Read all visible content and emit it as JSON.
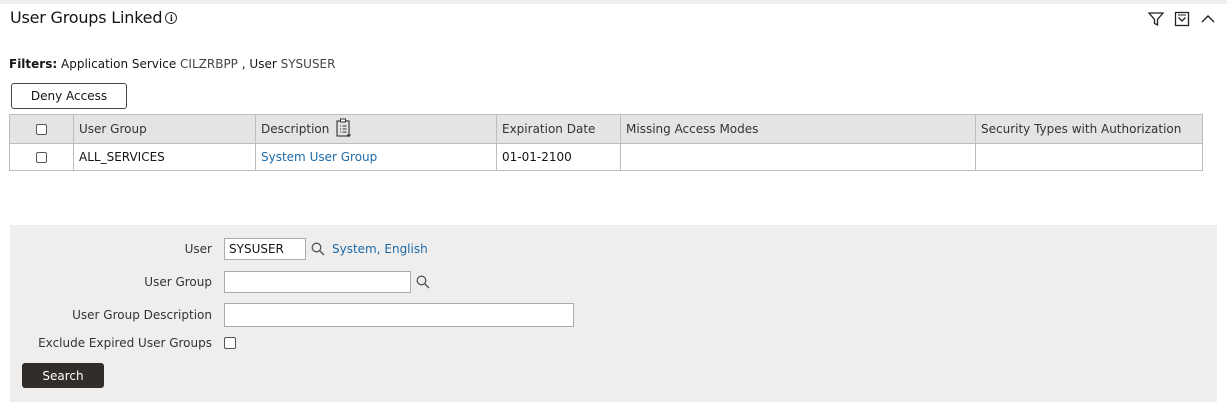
{
  "header": {
    "title": "User Groups Linked",
    "info_icon": "info-icon",
    "actions": [
      "filter-icon",
      "dropdown-box-icon",
      "chevron-up-icon"
    ]
  },
  "filters": {
    "label": "Filters:",
    "text_prefix": "Application Service",
    "service_value": "CILZRBPP",
    "separator": ",",
    "user_label": "User",
    "user_value": "SYSUSER"
  },
  "toolbar": {
    "deny_label": "Deny Access"
  },
  "table": {
    "columns": [
      "User Group",
      "Description",
      "Expiration Date",
      "Missing Access Modes",
      "Security Types with Authorization"
    ],
    "rows": [
      {
        "user_group": "ALL_SERVICES",
        "description": "System User Group",
        "expiration_date": "01-01-2100",
        "missing_access_modes": "",
        "security_types": ""
      }
    ]
  },
  "search": {
    "user_label": "User",
    "user_value": "SYSUSER",
    "user_description": "System, English",
    "user_group_label": "User Group",
    "user_group_value": "",
    "user_group_description_label": "User Group Description",
    "user_group_description_value": "",
    "exclude_label": "Exclude Expired User Groups",
    "exclude_checked": false,
    "search_label": "Search"
  },
  "colors": {
    "link": "#1e6aa7",
    "panel_bg": "#efeeed",
    "header_bg": "#e4e4e4",
    "button_dark": "#312d2a"
  }
}
